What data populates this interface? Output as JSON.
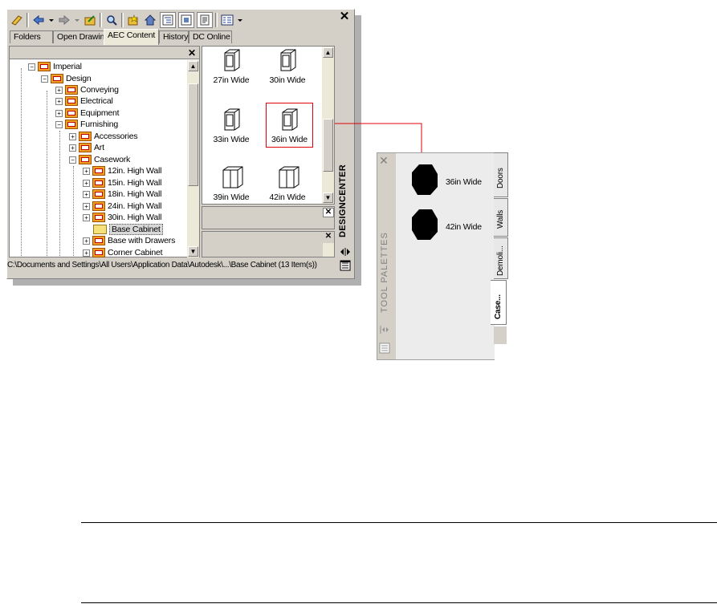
{
  "designcenter": {
    "vertical_title": "DESIGNCENTER",
    "tabs": [
      "Folders",
      "Open Drawings",
      "AEC Content",
      "History",
      "DC Online"
    ],
    "active_tab": "AEC Content",
    "tree": {
      "nodes": [
        {
          "label": "Imperial",
          "level": 0,
          "expander": "−"
        },
        {
          "label": "Design",
          "level": 1,
          "expander": "−"
        },
        {
          "label": "Conveying",
          "level": 2,
          "expander": "+"
        },
        {
          "label": "Electrical",
          "level": 2,
          "expander": "+"
        },
        {
          "label": "Equipment",
          "level": 2,
          "expander": "+"
        },
        {
          "label": "Furnishing",
          "level": 2,
          "expander": "−"
        },
        {
          "label": "Accessories",
          "level": 3,
          "expander": "+"
        },
        {
          "label": "Art",
          "level": 3,
          "expander": "+"
        },
        {
          "label": "Casework",
          "level": 3,
          "expander": "−"
        },
        {
          "label": "12in. High Wall",
          "level": 4,
          "expander": "+"
        },
        {
          "label": "15in. High Wall",
          "level": 4,
          "expander": "+"
        },
        {
          "label": "18in. High Wall",
          "level": 4,
          "expander": "+"
        },
        {
          "label": "24in. High Wall",
          "level": 4,
          "expander": "+"
        },
        {
          "label": "30in. High Wall",
          "level": 4,
          "expander": "+"
        },
        {
          "label": "Base Cabinet",
          "level": 4,
          "expander": "",
          "selected": true
        },
        {
          "label": "Base with Drawers",
          "level": 4,
          "expander": "+"
        },
        {
          "label": "Corner Cabinet",
          "level": 4,
          "expander": "+"
        }
      ]
    },
    "content_items": [
      "27in Wide",
      "30in Wide",
      "33in Wide",
      "36in Wide",
      "39in Wide",
      "42in Wide"
    ],
    "highlighted_item": "36in Wide",
    "status_path": "C:\\Documents and Settings\\All Users\\Application Data\\Autodesk\\...\\Base Cabinet (13 Item(s))",
    "close_glyph": "✕"
  },
  "tool_palette": {
    "vertical_title": "TOOL PALETTES",
    "tools": [
      "36in Wide",
      "42in Wide"
    ],
    "tabs": [
      "Doors",
      "Walls",
      "Demoli...",
      "Case..."
    ],
    "active_tab": "Case..."
  },
  "colors": {
    "highlight_red": "#e0000a",
    "window_face": "#d4d0c8"
  }
}
